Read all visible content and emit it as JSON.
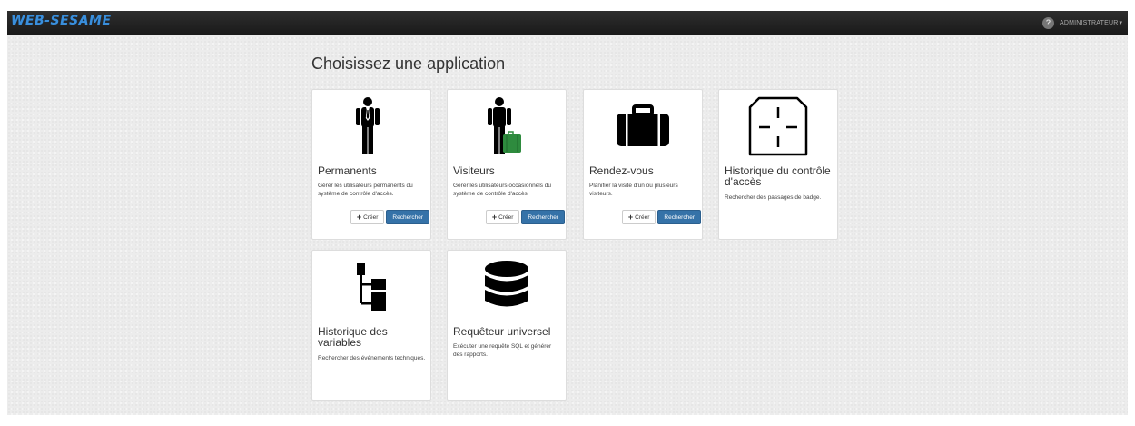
{
  "topbar": {
    "logo": "WEB-SESAME",
    "help_icon": "?",
    "user_label": "ADMINISTRATEUR",
    "caret": "▾"
  },
  "main": {
    "title": "Choisissez une application"
  },
  "cards": [
    {
      "icon": "person-icon",
      "title": "Permanents",
      "description": "Gérer les utilisateurs permanents du système de contrôle d'accès.",
      "create_label": "Créer",
      "search_label": "Rechercher"
    },
    {
      "icon": "visitor-icon",
      "title": "Visiteurs",
      "description": "Gérer les utilisateurs occasionnels du système de contrôle d'accès.",
      "create_label": "Créer",
      "search_label": "Rechercher"
    },
    {
      "icon": "briefcase-icon",
      "title": "Rendez-vous",
      "description": "Planifier la visite d'un ou plusieurs visiteurs.",
      "create_label": "Créer",
      "search_label": "Rechercher"
    },
    {
      "icon": "badge-reader-icon",
      "title": "Historique du contrôle d'accès",
      "description": "Rechercher des passages de badge."
    },
    {
      "icon": "tree-icon",
      "title": "Historique des variables",
      "description": "Rechercher des événements techniques."
    },
    {
      "icon": "database-icon",
      "title": "Requêteur universel",
      "description": "Exécuter une requête SQL et générer des rapports."
    }
  ],
  "colors": {
    "accent": "#3572a8",
    "luggage": "#2e8b3e",
    "topbar": "#222222"
  }
}
